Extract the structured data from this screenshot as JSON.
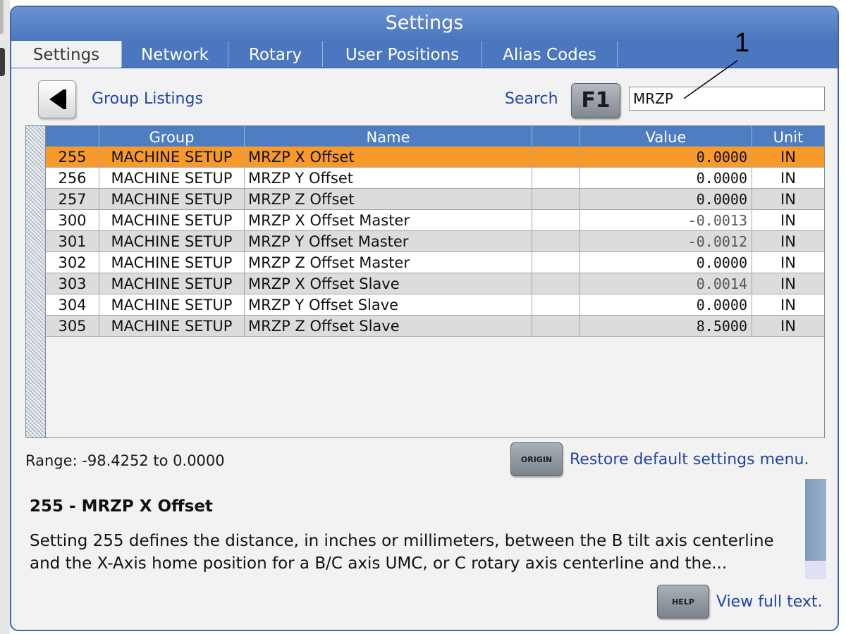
{
  "window": {
    "title": "Settings"
  },
  "tabs": [
    {
      "label": "Settings",
      "active": true
    },
    {
      "label": "Network",
      "active": false
    },
    {
      "label": "Rotary",
      "active": false
    },
    {
      "label": "User Positions",
      "active": false
    },
    {
      "label": "Alias Codes",
      "active": false
    }
  ],
  "toolbar": {
    "back_icon": "left-arrow-icon",
    "group_listings_label": "Group Listings",
    "search_label": "Search",
    "search_key_label": "F1",
    "search_value": "MRZP"
  },
  "callout": {
    "number": "1"
  },
  "table": {
    "columns": [
      "",
      "Group",
      "Name",
      "",
      "Value",
      "Unit"
    ],
    "rows": [
      {
        "num": "255",
        "group": "MACHINE SETUP",
        "name": "MRZP X Offset",
        "value": "0.0000",
        "unit": "IN",
        "selected": true
      },
      {
        "num": "256",
        "group": "MACHINE SETUP",
        "name": "MRZP Y Offset",
        "value": "0.0000",
        "unit": "IN",
        "selected": false
      },
      {
        "num": "257",
        "group": "MACHINE SETUP",
        "name": "MRZP Z Offset",
        "value": "0.0000",
        "unit": "IN",
        "selected": false
      },
      {
        "num": "300",
        "group": "MACHINE SETUP",
        "name": "MRZP X Offset Master",
        "value": "-0.0013",
        "unit": "IN",
        "selected": false
      },
      {
        "num": "301",
        "group": "MACHINE SETUP",
        "name": "MRZP Y Offset Master",
        "value": "-0.0012",
        "unit": "IN",
        "selected": false
      },
      {
        "num": "302",
        "group": "MACHINE SETUP",
        "name": "MRZP Z Offset Master",
        "value": "0.0000",
        "unit": "IN",
        "selected": false
      },
      {
        "num": "303",
        "group": "MACHINE SETUP",
        "name": "MRZP X Offset Slave",
        "value": "0.0014",
        "unit": "IN",
        "selected": false
      },
      {
        "num": "304",
        "group": "MACHINE SETUP",
        "name": "MRZP Y Offset Slave",
        "value": "0.0000",
        "unit": "IN",
        "selected": false
      },
      {
        "num": "305",
        "group": "MACHINE SETUP",
        "name": "MRZP Z Offset Slave",
        "value": "8.5000",
        "unit": "IN",
        "selected": false
      }
    ]
  },
  "footer": {
    "range_text": "Range: -98.4252 to 0.0000",
    "origin_key_label": "ORIGIN",
    "restore_label": "Restore default settings menu.",
    "help_key_label": "HELP",
    "view_full_label": "View full text."
  },
  "description": {
    "title": "255 - MRZP X Offset",
    "body": "Setting 255 defines the distance, in inches or millimeters, between the B tilt axis centerline and the X-Axis home position for a B/C axis UMC, or C rotary axis centerline and the..."
  },
  "colors": {
    "accent": "#4a77bf",
    "selected_row": "#f79a2a",
    "link": "#2144a8"
  }
}
